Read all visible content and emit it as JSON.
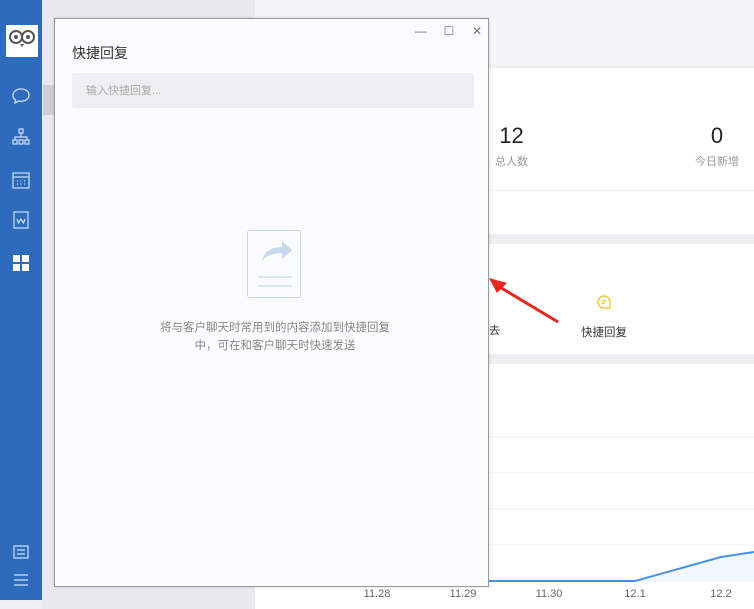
{
  "dialog": {
    "title": "快捷回复",
    "search_placeholder": "输入快捷回复...",
    "empty_text": "将与客户聊天时常用到的内容添加到快捷回复中，可在和客户聊天时快速发送",
    "window_buttons": {
      "minimize": "—",
      "maximize": "☐",
      "close": "✕"
    }
  },
  "stats": [
    {
      "value": "12",
      "label": "总人数"
    },
    {
      "value": "0",
      "label": "今日新增"
    }
  ],
  "tools": {
    "quick_reply_label": "快捷回复",
    "partial_label": "去"
  },
  "colors": {
    "sidebar": "#2f6bbd",
    "line": "#4a90e2",
    "arrow": "#e8251f",
    "quick_reply_icon": "#f0c020"
  },
  "chart_data": {
    "type": "line",
    "categories": [
      "11.28",
      "11.29",
      "11.30",
      "12.1",
      "12.2"
    ],
    "values": [
      0,
      0,
      0,
      0,
      2
    ],
    "ylim": [
      0,
      12
    ],
    "grid": true
  }
}
